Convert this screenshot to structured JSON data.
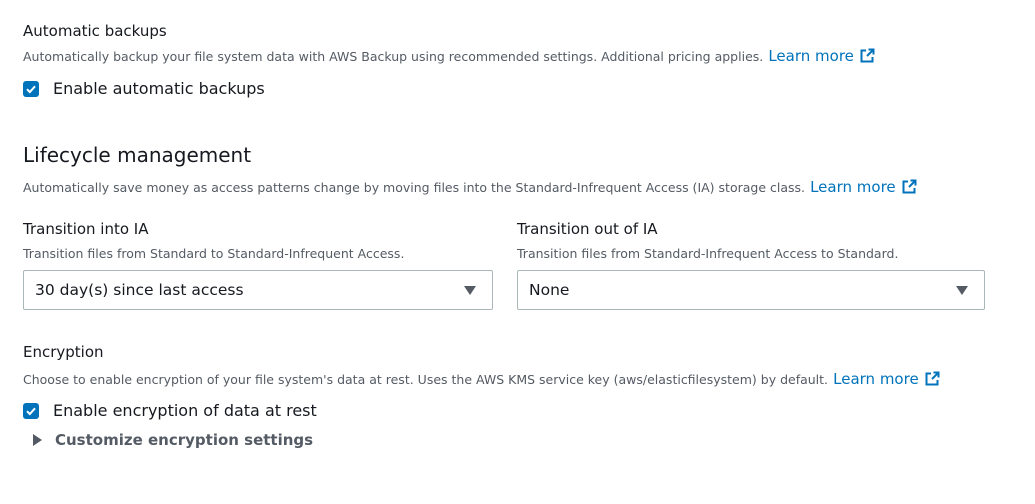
{
  "backups": {
    "title": "Automatic backups",
    "description": "Automatically backup your file system data with AWS Backup using recommended settings. Additional pricing applies.",
    "learn_more": "Learn more",
    "checkbox_label": "Enable automatic backups",
    "checked": true
  },
  "lifecycle": {
    "heading": "Lifecycle management",
    "description": "Automatically save money as access patterns change by moving files into the Standard-Infrequent Access (IA) storage class.",
    "learn_more": "Learn more",
    "transition_into": {
      "label": "Transition into IA",
      "description": "Transition files from Standard to Standard-Infrequent Access.",
      "value": "30 day(s) since last access"
    },
    "transition_out": {
      "label": "Transition out of IA",
      "description": "Transition files from Standard-Infrequent Access to Standard.",
      "value": "None"
    }
  },
  "encryption": {
    "title": "Encryption",
    "description": "Choose to enable encryption of your file system's data at rest. Uses the AWS KMS service key (aws/elasticfilesystem) by default.",
    "learn_more": "Learn more",
    "checkbox_label": "Enable encryption of data at rest",
    "checked": true,
    "customize_label": "Customize encryption settings"
  },
  "colors": {
    "link": "#0073bb",
    "checkbox": "#0073bb",
    "text": "#16191f",
    "secondary_text": "#545b64"
  },
  "icons": [
    "external-link-icon",
    "check-icon",
    "caret-down-icon",
    "caret-right-icon"
  ]
}
